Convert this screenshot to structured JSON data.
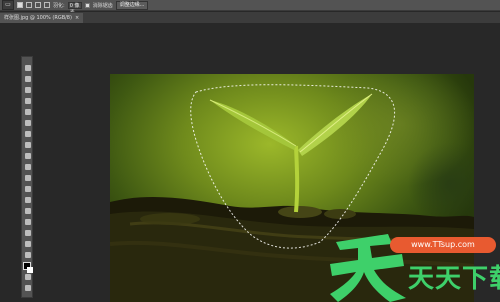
{
  "options_bar": {
    "tool_preset_glyph": "▭",
    "feather_label": "羽化:",
    "feather_value": "0 像素",
    "antialias_label": "消除锯齿",
    "refine_edge_label": "调整边缘..."
  },
  "document_tab": {
    "label": "样张图.jpg @ 100% (RGB/8)",
    "close_glyph": "×"
  },
  "colors": {
    "foreground": "#000000",
    "background": "#ffffff",
    "accent": "#e85a30",
    "brand_green": "#3ed06a"
  },
  "watermark": {
    "url": "www.TTsup.com",
    "logo_chars": "天天下载"
  }
}
